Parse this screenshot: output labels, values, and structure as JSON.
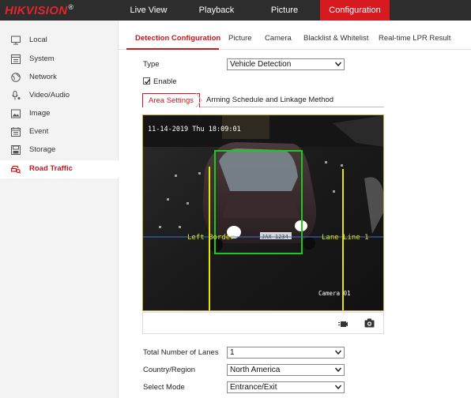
{
  "brand": {
    "logo_text": "HIKVISION",
    "logo_reg": "®"
  },
  "topnav": {
    "items": [
      {
        "label": "Live View"
      },
      {
        "label": "Playback"
      },
      {
        "label": "Picture"
      },
      {
        "label": "Configuration"
      }
    ],
    "active": "Configuration"
  },
  "sidebar": {
    "items": [
      {
        "label": "Local",
        "icon": "monitor-icon"
      },
      {
        "label": "System",
        "icon": "system-icon"
      },
      {
        "label": "Network",
        "icon": "globe-icon"
      },
      {
        "label": "Video/Audio",
        "icon": "mic-icon"
      },
      {
        "label": "Image",
        "icon": "image-icon"
      },
      {
        "label": "Event",
        "icon": "calendar-icon"
      },
      {
        "label": "Storage",
        "icon": "storage-icon"
      },
      {
        "label": "Road Traffic",
        "icon": "car-search-icon"
      }
    ],
    "active": "Road Traffic"
  },
  "subtabs": {
    "items": [
      {
        "label": "Detection Configuration"
      },
      {
        "label": "Picture"
      },
      {
        "label": "Camera"
      },
      {
        "label": "Blacklist & Whitelist"
      },
      {
        "label": "Real-time LPR Result"
      }
    ],
    "active": "Detection Configuration"
  },
  "form": {
    "type_label": "Type",
    "type_value": "Vehicle Detection",
    "enable_label": "Enable",
    "enable_checked": true,
    "lanes_label": "Total Number of Lanes",
    "lanes_value": "1",
    "country_label": "Country/Region",
    "country_value": "North America",
    "mode_label": "Select Mode",
    "mode_value": "Entrance/Exit"
  },
  "inner_tabs": {
    "area": "Area Settings",
    "arming": "Arming Schedule and Linkage Method"
  },
  "video": {
    "timestamp": "11-14-2019 Thu 18:09:01",
    "left_border_label": "Left Border",
    "lane_line_label": "Lane Line 1",
    "camera_label": "Camera 01",
    "plate_text": "JAX 1234"
  },
  "colors": {
    "accent": "#d71920",
    "topbar": "#2d2d2d",
    "detection_box": "#1ec81e",
    "lane_line": "#e6e600",
    "border_line": "#3a6fd8"
  }
}
